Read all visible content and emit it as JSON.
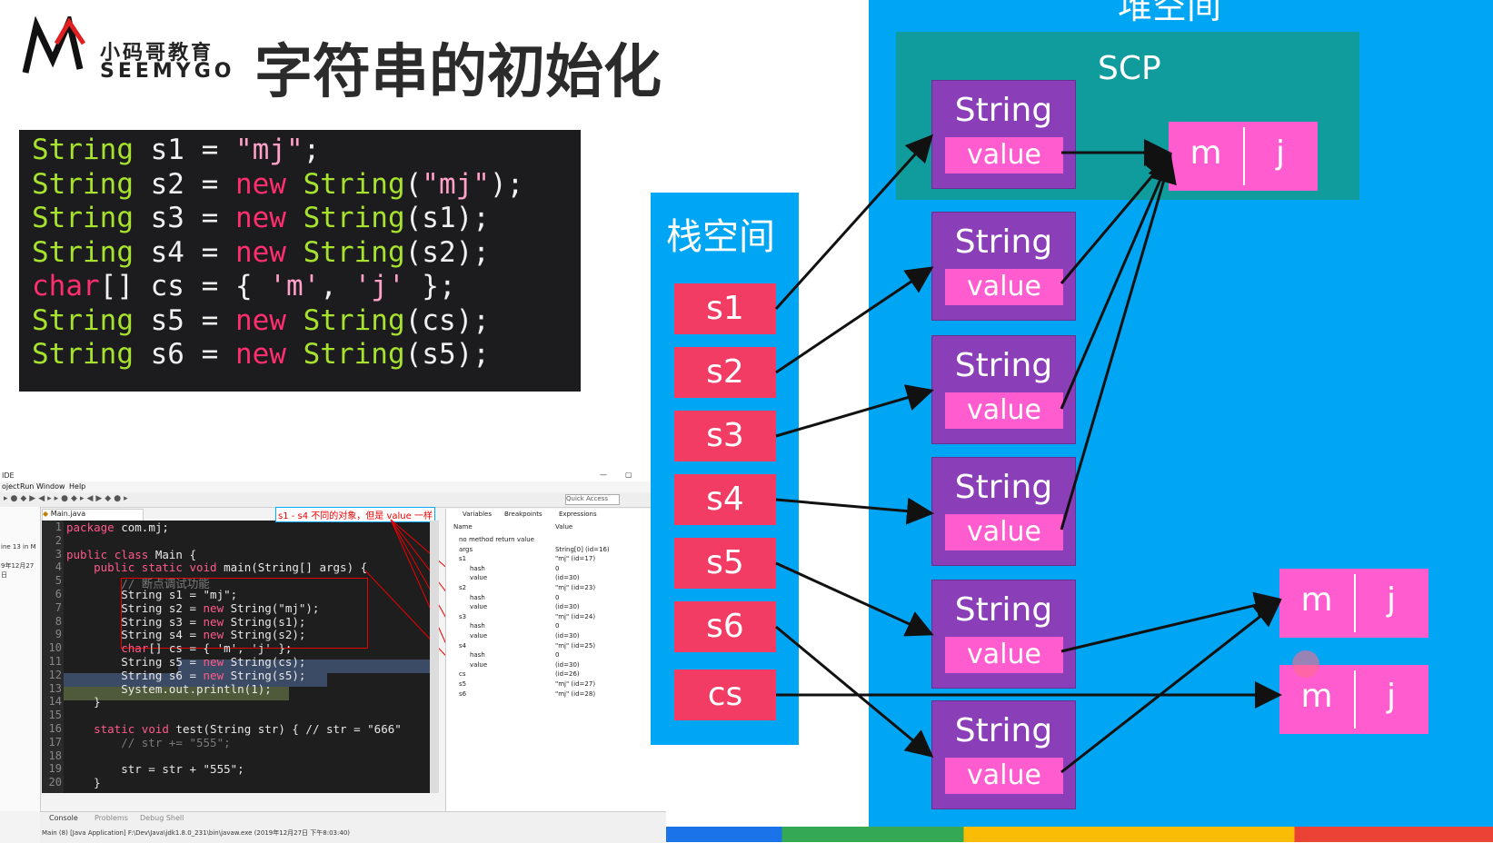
{
  "header": {
    "logo_cn": "小码哥教育",
    "logo_en": "SEEMYGO",
    "title": "字符串的初始化"
  },
  "code": [
    [
      [
        "ty",
        "String"
      ],
      [
        "pl",
        " s1 = "
      ],
      [
        "st",
        "\"mj\""
      ],
      [
        "pl",
        ";"
      ]
    ],
    [
      [
        "ty",
        "String"
      ],
      [
        "pl",
        " s2 = "
      ],
      [
        "kw",
        "new"
      ],
      [
        "pl",
        " "
      ],
      [
        "ty",
        "String"
      ],
      [
        "pl",
        "("
      ],
      [
        "st",
        "\"mj\""
      ],
      [
        "pl",
        ");"
      ]
    ],
    [
      [
        "ty",
        "String"
      ],
      [
        "pl",
        " s3 = "
      ],
      [
        "kw",
        "new"
      ],
      [
        "pl",
        " "
      ],
      [
        "ty",
        "String"
      ],
      [
        "pl",
        "(s1);"
      ]
    ],
    [
      [
        "ty",
        "String"
      ],
      [
        "pl",
        " s4 = "
      ],
      [
        "kw",
        "new"
      ],
      [
        "pl",
        " "
      ],
      [
        "ty",
        "String"
      ],
      [
        "pl",
        "(s2);"
      ]
    ],
    [
      [
        "kw",
        "char"
      ],
      [
        "pl",
        "[] cs = { "
      ],
      [
        "st",
        "'m'"
      ],
      [
        "pl",
        ", "
      ],
      [
        "st",
        "'j'"
      ],
      [
        "pl",
        " };"
      ]
    ],
    [
      [
        "ty",
        "String"
      ],
      [
        "pl",
        " s5 = "
      ],
      [
        "kw",
        "new"
      ],
      [
        "pl",
        " "
      ],
      [
        "ty",
        "String"
      ],
      [
        "pl",
        "(cs);"
      ]
    ],
    [
      [
        "ty",
        "String"
      ],
      [
        "pl",
        " s6 = "
      ],
      [
        "kw",
        "new"
      ],
      [
        "pl",
        " "
      ],
      [
        "ty",
        "String"
      ],
      [
        "pl",
        "(s5);"
      ]
    ]
  ],
  "ide": {
    "title": "IDE",
    "menu": [
      "oject",
      "Run",
      "Window",
      "Help"
    ],
    "quick_access": "Quick Access",
    "tab": "Main.java",
    "left_notes": [
      "ine 13 in M",
      "9年12月27日"
    ],
    "annotation": "s1 - s4 不同的对象，但是 value 一样",
    "lines": [
      "package com.mj;",
      "",
      "public class Main {",
      "    public static void main(String[] args) {",
      "        // 断点调试功能",
      "        String s1 = \"mj\";",
      "        String s2 = new String(\"mj\");",
      "        String s3 = new String(s1);",
      "        String s4 = new String(s2);",
      "        char[] cs = { 'm', 'j' };",
      "        String s5 = new String(cs);",
      "        String s6 = new String(s5);",
      "        System.out.println(1);",
      "    }",
      "",
      "    static void test(String str) { // str = \"666\"",
      "        // str += \"555\";",
      "",
      "        str = str + \"555\";",
      "    }"
    ],
    "panel_tabs": [
      "Variables",
      "Breakpoints",
      "Expressions"
    ],
    "var_headers": [
      "Name",
      "Value"
    ],
    "vars": [
      [
        "no method return value",
        ""
      ],
      [
        "args",
        "String[0]  (id=16)"
      ],
      [
        "s1",
        "\"mj\" (id=17)"
      ],
      [
        "hash",
        "0"
      ],
      [
        "value",
        "(id=30)"
      ],
      [
        "s2",
        "\"mj\" (id=23)"
      ],
      [
        "hash",
        "0"
      ],
      [
        "value",
        "(id=30)"
      ],
      [
        "s3",
        "\"mj\" (id=24)"
      ],
      [
        "hash",
        "0"
      ],
      [
        "value",
        "(id=30)"
      ],
      [
        "s4",
        "\"mj\" (id=25)"
      ],
      [
        "hash",
        "0"
      ],
      [
        "value",
        "(id=30)"
      ],
      [
        "cs",
        "(id=26)"
      ],
      [
        "s5",
        "\"mj\" (id=27)"
      ],
      [
        "s6",
        "\"mj\" (id=28)"
      ]
    ],
    "console_tabs": [
      "Console",
      "Problems",
      "Debug Shell"
    ],
    "console_line": "Main (8) [Java Application] F:\\Dev\\Java\\jdk1.8.0_231\\bin\\javaw.exe (2019年12月27日 下午8:03:40)"
  },
  "diagram": {
    "heap_title": "堆空间",
    "scp_label": "SCP",
    "stack_title": "栈空间",
    "vars": [
      "s1",
      "s2",
      "s3",
      "s4",
      "s5",
      "s6",
      "cs"
    ],
    "string_label": "String",
    "value_label": "value",
    "arrays": [
      {
        "cells": [
          "m",
          "j"
        ]
      },
      {
        "cells": [
          "m",
          "j"
        ]
      },
      {
        "cells": [
          "m",
          "j"
        ]
      }
    ],
    "colors": {
      "heap": "#00a6f3",
      "scp": "#109c9c",
      "stack": "#00a6f3",
      "var_box": "#f23c64",
      "string_obj": "#8a3fb8",
      "value_box": "#ff5cd0",
      "array": "#ff5cd0"
    }
  }
}
